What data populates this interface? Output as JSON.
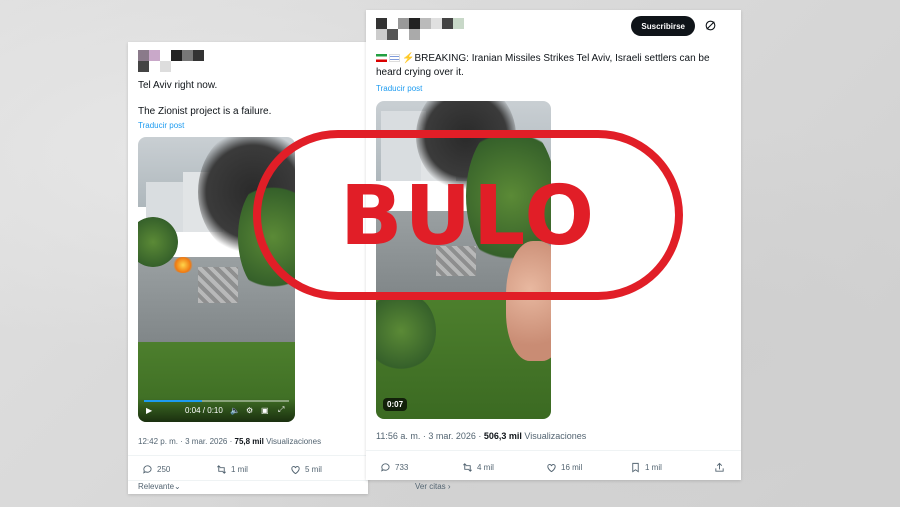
{
  "left_post": {
    "text_line1": "Tel Aviv right now.",
    "text_line2": "The Zionist project is a failure.",
    "translate": "Traducir post",
    "video": {
      "time": "0:04 / 0:10",
      "progress": 0.4
    },
    "meta": {
      "time_date": "12:42 p. m. · 3 mar. 2026 · ",
      "views_count": "75,8 mil",
      "views_label": " Visualizaciones"
    },
    "actions": {
      "replies": "250",
      "reposts": "1 mil",
      "likes": "5 mil"
    },
    "footer": {
      "relevant": "Relevante"
    }
  },
  "right_post": {
    "subscribe": "Suscribirse",
    "text": "⚡BREAKING: Iranian Missiles Strikes Tel Aviv, Israeli settlers can be heard crying over it.",
    "translate": "Traducir post",
    "video": {
      "duration": "0:07"
    },
    "meta": {
      "time_date": "11:56 a. m. · 3 mar. 2026 · ",
      "views_count": "506,3 mil",
      "views_label": " Visualizaciones"
    },
    "actions": {
      "replies": "733",
      "reposts": "4 mil",
      "likes": "16 mil",
      "bookmarks": "1 mil"
    },
    "footer": {
      "quotes": "Ver citas"
    }
  },
  "stamp": {
    "label": "BULO",
    "color": "#e11e27"
  },
  "colors": {
    "link": "#1d9bf0",
    "muted": "#536471"
  }
}
